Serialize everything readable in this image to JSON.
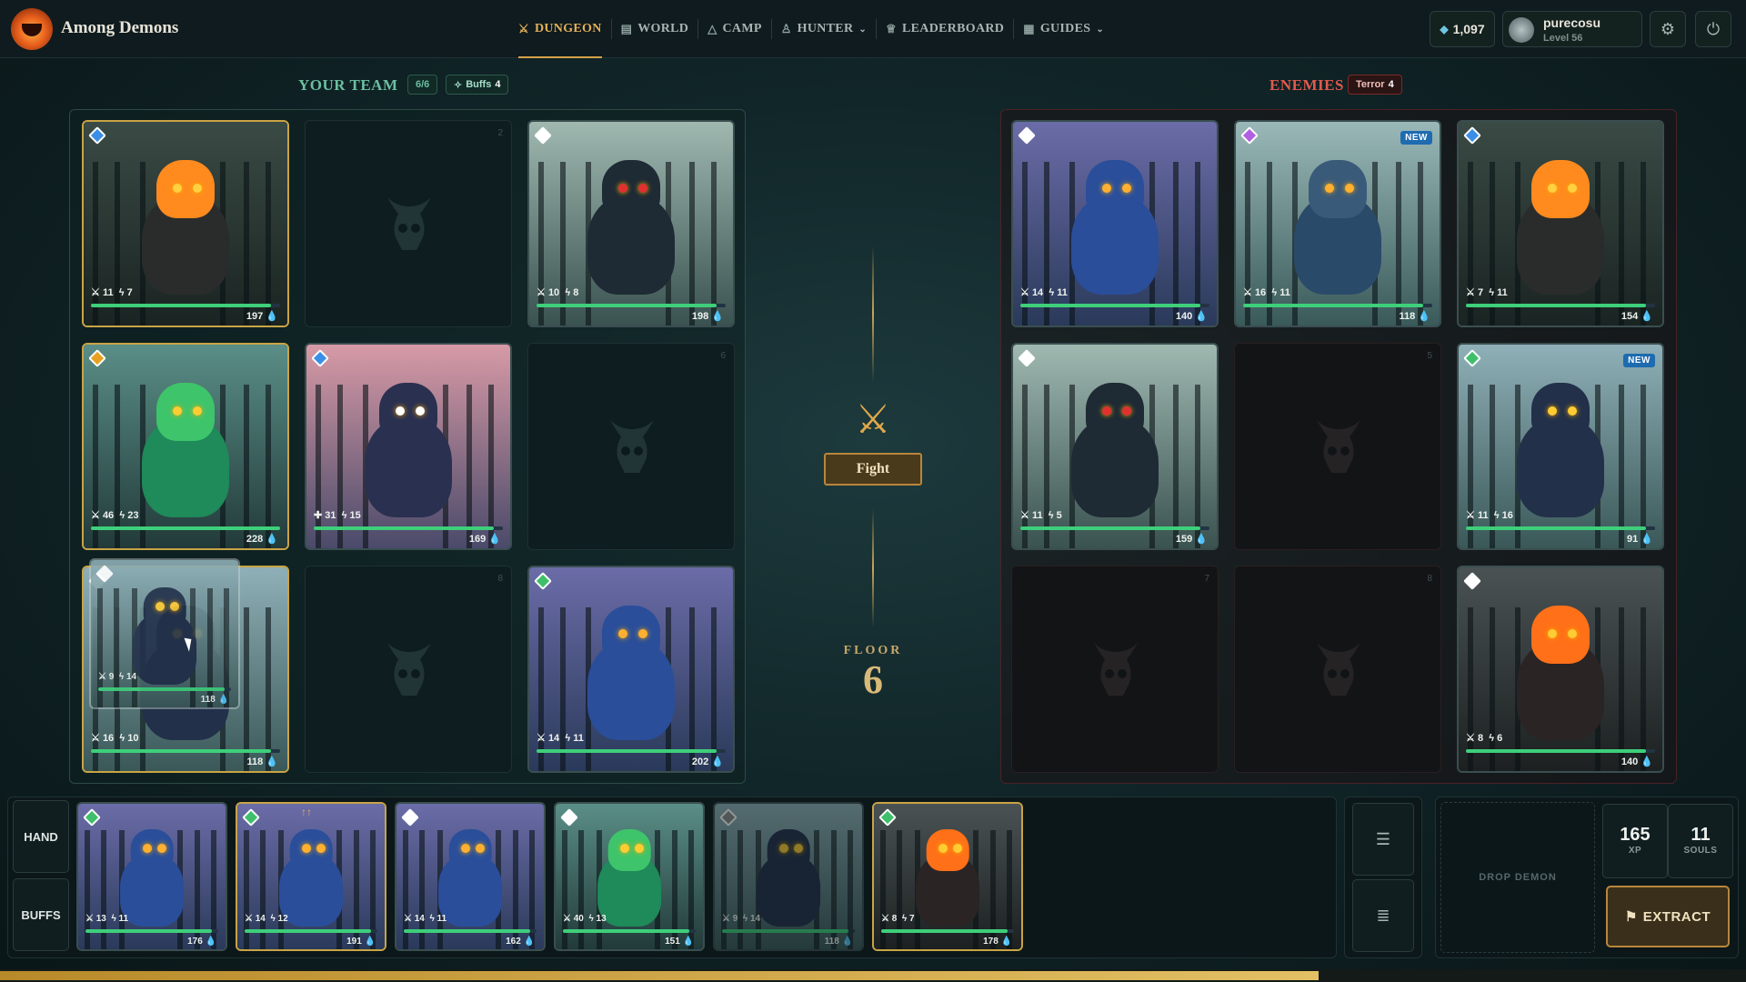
{
  "app": {
    "brand": "Among Demons"
  },
  "nav": {
    "items": [
      {
        "label": "DUNGEON",
        "icon": "crossed-swords-icon",
        "active": true
      },
      {
        "label": "WORLD",
        "icon": "map-icon"
      },
      {
        "label": "CAMP",
        "icon": "tent-icon"
      },
      {
        "label": "HUNTER",
        "icon": "user-icon",
        "dropdown": true
      },
      {
        "label": "LEADERBOARD",
        "icon": "trophy-icon"
      },
      {
        "label": "GUIDES",
        "icon": "book-icon",
        "dropdown": true
      }
    ]
  },
  "account": {
    "currency": "1,097",
    "currency_icon": "gem-icon",
    "username": "purecosu",
    "level": "Level 56"
  },
  "team": {
    "title": "YOUR TEAM",
    "count": "6/6",
    "buffs_label": "Buffs",
    "buffs_count": "4"
  },
  "enemies": {
    "title": "ENEMIES",
    "terror_label": "Terror",
    "terror_count": "4"
  },
  "center": {
    "fight_label": "Fight",
    "floor_label": "FLOOR",
    "floor_number": "6"
  },
  "team_slots": [
    {
      "slot": 1,
      "atk": "11",
      "spd": "7",
      "hp": "197",
      "hp_pct": 0.95,
      "gem": "#3a8ee6",
      "border": "#c9a445",
      "palette": "fire",
      "icons": [
        "sword-icon",
        "bolt-icon"
      ]
    },
    {
      "slot": 2,
      "empty": true,
      "number": "2"
    },
    {
      "slot": 3,
      "atk": "10",
      "spd": "8",
      "hp": "198",
      "hp_pct": 0.95,
      "gem": "#ffffff",
      "border": "#3a4e50",
      "palette": "bull",
      "icons": [
        "sword-icon",
        "bolt-icon"
      ]
    },
    {
      "slot": 4,
      "atk": "46",
      "spd": "23",
      "hp": "228",
      "hp_pct": 1.0,
      "gem": "#e8a020",
      "border": "#c9a445",
      "palette": "slime",
      "icons": [
        "sword-icon",
        "bolt-icon"
      ]
    },
    {
      "slot": 5,
      "atk": "31",
      "spd": "15",
      "hp": "169",
      "hp_pct": 0.95,
      "gem": "#3a8ee6",
      "border": "#3a4e50",
      "palette": "robe",
      "icons": [
        "shield-icon",
        "bolt-icon"
      ]
    },
    {
      "slot": 6,
      "empty": true,
      "number": "6"
    },
    {
      "slot": 7,
      "atk": "16",
      "spd": "10",
      "hp": "118",
      "hp_pct": 0.95,
      "gem": "#ffffff",
      "border": "#c9a445",
      "palette": "wing",
      "icons": [
        "sword-icon",
        "bolt-icon"
      ]
    },
    {
      "slot": 8,
      "empty": true,
      "number": "8"
    },
    {
      "slot": 9,
      "atk": "14",
      "spd": "11",
      "hp": "202",
      "hp_pct": 0.95,
      "gem": "#3fbf6a",
      "border": "#3a4e50",
      "palette": "owl",
      "icons": [
        "sword-icon",
        "bolt-icon"
      ]
    }
  ],
  "enemy_slots": [
    {
      "slot": 1,
      "atk": "14",
      "spd": "11",
      "hp": "140",
      "hp_pct": 0.95,
      "gem": "#ffffff",
      "border": "#3a4e50",
      "palette": "owl"
    },
    {
      "slot": 2,
      "atk": "16",
      "spd": "11",
      "hp": "118",
      "hp_pct": 0.95,
      "gem": "#b060e0",
      "border": "#3a4e50",
      "palette": "bug",
      "new": "NEW"
    },
    {
      "slot": 3,
      "atk": "7",
      "spd": "11",
      "hp": "154",
      "hp_pct": 0.95,
      "gem": "#3a8ee6",
      "border": "#3a4e50",
      "palette": "fire"
    },
    {
      "slot": 4,
      "atk": "11",
      "spd": "5",
      "hp": "159",
      "hp_pct": 0.95,
      "gem": "#ffffff",
      "border": "#3a4e50",
      "palette": "bull"
    },
    {
      "slot": 5,
      "empty": true,
      "number": "5"
    },
    {
      "slot": 6,
      "atk": "11",
      "spd": "16",
      "hp": "91",
      "hp_pct": 0.95,
      "gem": "#3fbf6a",
      "border": "#3a4e50",
      "palette": "wing",
      "new": "NEW"
    },
    {
      "slot": 7,
      "empty": true,
      "number": "7"
    },
    {
      "slot": 8,
      "empty": true,
      "number": "8"
    },
    {
      "slot": 9,
      "atk": "8",
      "spd": "6",
      "hp": "140",
      "hp_pct": 0.95,
      "gem": "#ffffff",
      "border": "#3a4e50",
      "palette": "flame"
    }
  ],
  "drag": {
    "atk": "9",
    "spd": "14",
    "hp": "118"
  },
  "hand": {
    "tabs": [
      "HAND",
      "BUFFS"
    ],
    "cards": [
      {
        "atk": "13",
        "spd": "11",
        "hp": "176",
        "gem": "#3fbf6a",
        "border": "#3a4e50",
        "palette": "owl"
      },
      {
        "atk": "14",
        "spd": "12",
        "hp": "191",
        "gem": "#3fbf6a",
        "border": "#c9a445",
        "palette": "owl",
        "upgrade": "↑↑"
      },
      {
        "atk": "14",
        "spd": "11",
        "hp": "162",
        "gem": "#ffffff",
        "border": "#3a4e50",
        "palette": "owl"
      },
      {
        "atk": "40",
        "spd": "13",
        "hp": "151",
        "gem": "#ffffff",
        "border": "#3a4e50",
        "palette": "slime"
      },
      {
        "atk": "9",
        "spd": "14",
        "hp": "118",
        "gem": "#888888",
        "border": "#3a4e50",
        "palette": "wing",
        "dim": true
      },
      {
        "atk": "8",
        "spd": "7",
        "hp": "178",
        "gem": "#3fbf6a",
        "border": "#c9a445",
        "palette": "flame"
      }
    ]
  },
  "tools": {
    "sort_icon": "sort-icon",
    "list_icon": "list-icon"
  },
  "drop": {
    "label": "DROP DEMON"
  },
  "stats": {
    "xp": "165",
    "xp_label": "XP",
    "souls": "11",
    "souls_label": "SOULS"
  },
  "extract": {
    "label": "EXTRACT",
    "icon": "flag-icon"
  },
  "progress": {
    "fraction": 0.755
  },
  "colors": {
    "accent": "#d6a24a",
    "team": "#6bbfa0",
    "enemy": "#e05a4e",
    "hp": "#3ecf7a"
  }
}
